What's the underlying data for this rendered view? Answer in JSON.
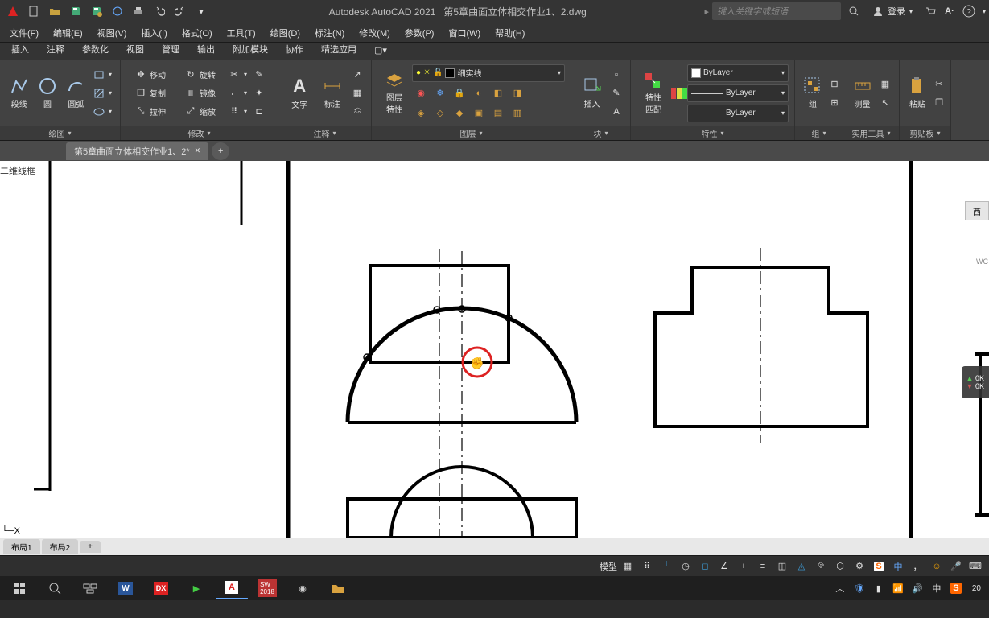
{
  "title": {
    "app": "Autodesk AutoCAD 2021",
    "file": "第5章曲面立体相交作业1、2.dwg"
  },
  "search": {
    "placeholder": "键入关键字或短语",
    "icon": "search-icon",
    "user_label": "登录"
  },
  "menus": [
    "文件(F)",
    "编辑(E)",
    "视图(V)",
    "插入(I)",
    "格式(O)",
    "工具(T)",
    "绘图(D)",
    "标注(N)",
    "修改(M)",
    "参数(P)",
    "窗口(W)",
    "帮助(H)"
  ],
  "ribbon_tabs": [
    "插入",
    "注释",
    "参数化",
    "视图",
    "管理",
    "输出",
    "附加模块",
    "协作",
    "精选应用"
  ],
  "active_ribbon_tab": 0,
  "panels": {
    "draw": {
      "label": "绘图",
      "items": {
        "polyline": "段线",
        "circle": "圆",
        "arc": "圆弧"
      }
    },
    "modify": {
      "label": "修改",
      "items": {
        "move": "移动",
        "rotate": "旋转",
        "copy": "复制",
        "mirror": "镜像",
        "stretch": "拉伸",
        "scale": "缩放"
      }
    },
    "annotate": {
      "label": "注释",
      "items": {
        "text": "文字",
        "dim": "标注"
      }
    },
    "layers": {
      "label": "图层",
      "items": {
        "props": "图层\n特性"
      },
      "line_style": "细实线"
    },
    "block": {
      "label": "块",
      "items": {
        "insert": "插入"
      }
    },
    "properties": {
      "label": "特性",
      "items": {
        "match": "特性\n匹配"
      },
      "layer_name": "ByLayer",
      "line_by": "ByLayer",
      "style_by": "ByLayer"
    },
    "group": {
      "label": "组",
      "items": {
        "group": "组"
      }
    },
    "utility": {
      "label": "实用工具",
      "items": {
        "measure": "测量"
      }
    },
    "clipboard": {
      "label": "剪贴板",
      "items": {
        "paste": "粘贴"
      }
    }
  },
  "doc_tabs": [
    {
      "name": "第5章曲面立体相交作业1、2*",
      "active": true
    }
  ],
  "viewport": {
    "label_2d": "二维线框",
    "side_tab": "西",
    "wcs": "WC",
    "coords": {
      "a": "0K",
      "b": "0K"
    }
  },
  "model_tabs": [
    "布局1",
    "布局2"
  ],
  "status": {
    "model": "模型"
  },
  "taskbar": {
    "ime": "中",
    "time": "20"
  }
}
